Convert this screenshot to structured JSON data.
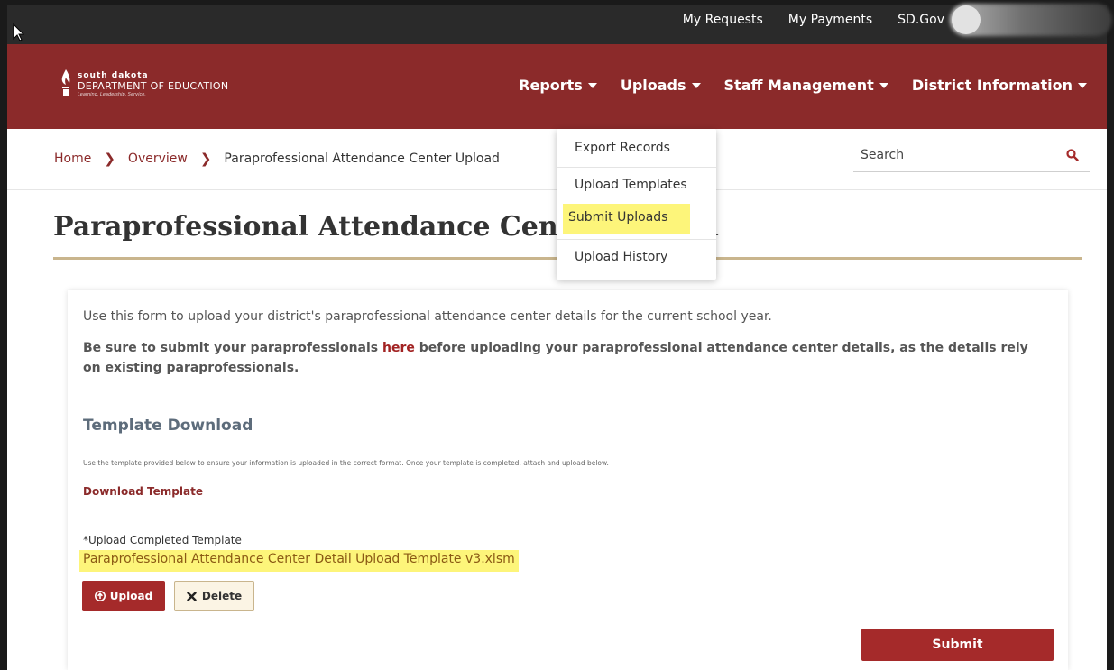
{
  "utility_nav": {
    "links": [
      "My Requests",
      "My Payments",
      "SD.Gov"
    ]
  },
  "logo": {
    "line1": "south dakota",
    "line2": "DEPARTMENT OF EDUCATION",
    "tagline": "Learning. Leadership. Service."
  },
  "main_nav": {
    "items": [
      "Reports",
      "Uploads",
      "Staff Management",
      "District Information"
    ]
  },
  "breadcrumb": {
    "home": "Home",
    "overview": "Overview",
    "current": "Paraprofessional Attendance Center Upload"
  },
  "search": {
    "placeholder": "Search"
  },
  "page": {
    "title": "Paraprofessional Attendance Center Upload"
  },
  "uploads_menu": {
    "items": [
      "Export Records",
      "Upload Templates",
      "Submit Uploads",
      "Upload History"
    ],
    "highlighted": "Submit Uploads"
  },
  "form": {
    "intro": "Use this form to upload your district's paraprofessional attendance center details for the current school year.",
    "notice_before": "Be sure to submit your paraprofessionals ",
    "notice_link": "here",
    "notice_after": " before uploading your paraprofessional attendance center details, as the details rely on existing paraprofessionals.",
    "template_heading": "Template Download",
    "template_note": "Use the template provided below to ensure your information is uploaded in the correct format. Once your template is completed, attach and upload below.",
    "download_link": "Download Template",
    "upload_required_mark": "*",
    "upload_label": "Upload Completed Template",
    "file_name": "Paraprofessional Attendance Center Detail Upload Template v3.xlsm",
    "upload_button": "Upload",
    "delete_button": "Delete",
    "submit_button": "Submit"
  },
  "colors": {
    "brand_maroon": "#8b2a2a",
    "button_red": "#a52a2a",
    "gold_rule": "#c9b58d",
    "highlight_yellow": "#fdf57a"
  }
}
